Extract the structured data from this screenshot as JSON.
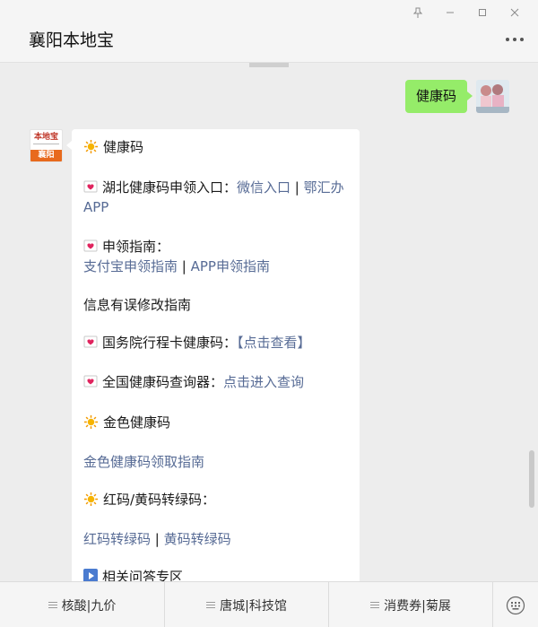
{
  "window": {
    "title": "襄阳本地宝",
    "controls": [
      "pin-icon",
      "minimize-icon",
      "maximize-icon",
      "close-icon"
    ]
  },
  "chat": {
    "outgoing": {
      "text": "健康码"
    },
    "incoming": {
      "avatar_text": {
        "top": "本地宝",
        "bottom": "襄阳"
      },
      "lines": {
        "l1_text": "健康码",
        "l2_label": "湖北健康码申领入口：",
        "l2_link1": "微信入口",
        "l2_sep": " | ",
        "l2_link2a": "鄂汇办",
        "l2_link2b": "APP",
        "l3_label": "申领指南：",
        "l3_link1": "支付宝申领指南",
        "l3_sep": " | ",
        "l3_link2": "APP申领指南",
        "l4_text": "信息有误修改指南",
        "l5_label": "国务院行程卡健康码：",
        "l5_link": "【点击查看】",
        "l6_label": "全国健康码查询器：",
        "l6_link": "点击进入查询",
        "l7_text": "金色健康码",
        "l8_link": "金色健康码领取指南",
        "l9_text": "红码/黄码转绿码：",
        "l10_link1": "红码转绿码",
        "l10_sep": " | ",
        "l10_link2": "黄码转绿码",
        "l11_text": "相关问答专区"
      }
    }
  },
  "bottom_menu": {
    "items": [
      "核酸|九价",
      "唐城|科技馆",
      "消费券|菊展"
    ],
    "keyboard_icon": "keyboard-toggle-icon"
  },
  "colors": {
    "background": "#ededed",
    "green_bubble": "#95ec69",
    "link": "#576b95"
  }
}
